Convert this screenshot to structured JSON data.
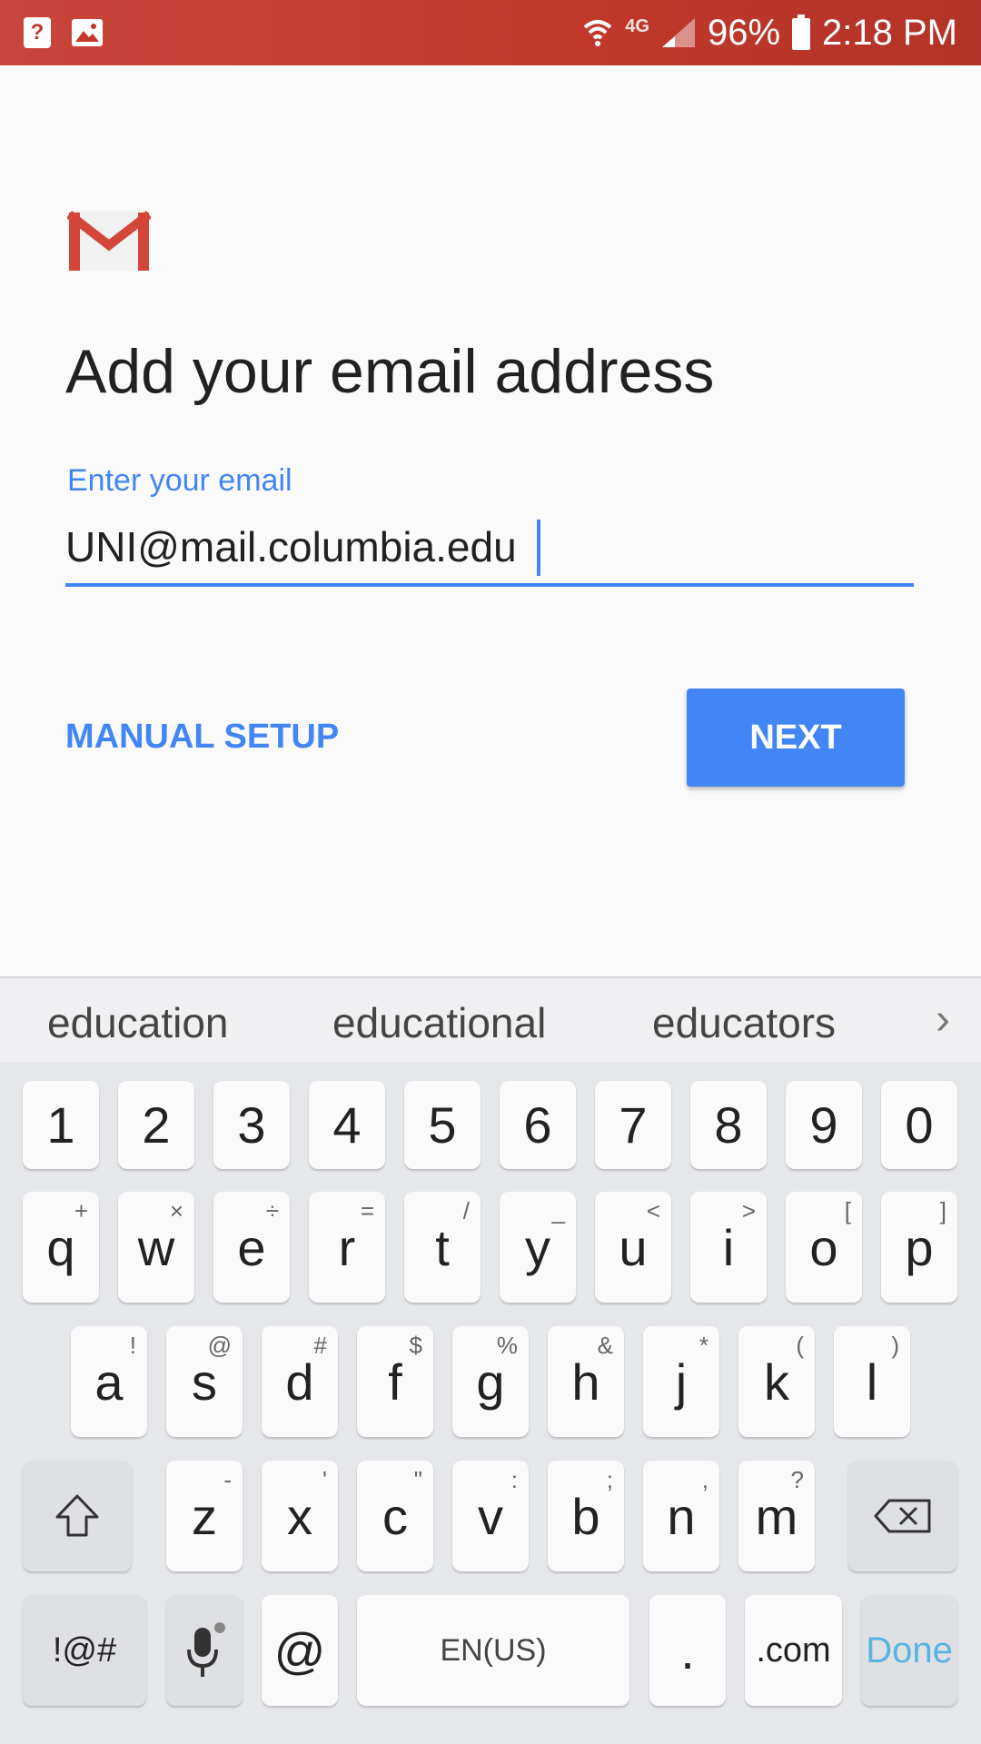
{
  "status_bar": {
    "network": "4G",
    "battery": "96%",
    "time": "2:18 PM",
    "icons": [
      "help-icon",
      "image-icon",
      "wifi-icon",
      "signal-icon",
      "battery-icon"
    ]
  },
  "page": {
    "title": "Add your email address",
    "field_label": "Enter your email",
    "email_value": "UNI@mail.columbia.edu",
    "manual_setup": "MANUAL SETUP",
    "next": "NEXT"
  },
  "colors": {
    "accent": "#4285f4",
    "status_bar": "#c0392b",
    "done": "#57b3e0"
  },
  "keyboard": {
    "suggestions": [
      "education",
      "educational",
      "educators"
    ],
    "row_numbers": [
      "1",
      "2",
      "3",
      "4",
      "5",
      "6",
      "7",
      "8",
      "9",
      "0"
    ],
    "row_top": [
      {
        "k": "q",
        "s": "+"
      },
      {
        "k": "w",
        "s": "×"
      },
      {
        "k": "e",
        "s": "÷"
      },
      {
        "k": "r",
        "s": "="
      },
      {
        "k": "t",
        "s": "/"
      },
      {
        "k": "y",
        "s": "_"
      },
      {
        "k": "u",
        "s": "<"
      },
      {
        "k": "i",
        "s": ">"
      },
      {
        "k": "o",
        "s": "["
      },
      {
        "k": "p",
        "s": "]"
      }
    ],
    "row_mid": [
      {
        "k": "a",
        "s": "!"
      },
      {
        "k": "s",
        "s": "@"
      },
      {
        "k": "d",
        "s": "#"
      },
      {
        "k": "f",
        "s": "$"
      },
      {
        "k": "g",
        "s": "%"
      },
      {
        "k": "h",
        "s": "&"
      },
      {
        "k": "j",
        "s": "*"
      },
      {
        "k": "k",
        "s": "("
      },
      {
        "k": "l",
        "s": ")"
      }
    ],
    "row_bottom": [
      {
        "k": "z",
        "s": "-"
      },
      {
        "k": "x",
        "s": "'"
      },
      {
        "k": "c",
        "s": "\""
      },
      {
        "k": "v",
        "s": ":"
      },
      {
        "k": "b",
        "s": ";"
      },
      {
        "k": "n",
        "s": ","
      },
      {
        "k": "m",
        "s": "?"
      }
    ],
    "symbols": "!@#",
    "at": "@",
    "space": "EN(US)",
    "period": ".",
    "dotcom": ".com",
    "done": "Done"
  }
}
